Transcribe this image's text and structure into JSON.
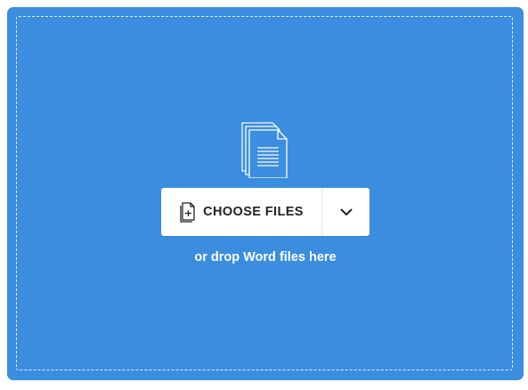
{
  "uploader": {
    "background_color": "#3b8ddf",
    "illustration_icon": "word-documents-icon",
    "choose_button": {
      "label": "CHOOSE FILES",
      "icon": "file-plus-icon"
    },
    "dropdown_icon": "chevron-down-icon",
    "drop_hint": "or drop Word files here"
  }
}
